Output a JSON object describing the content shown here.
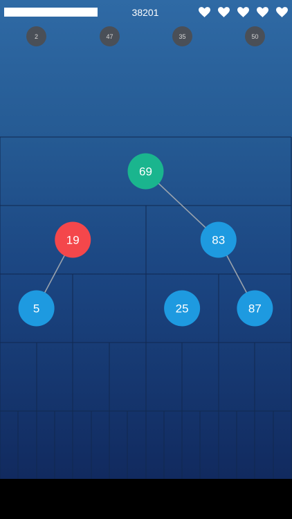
{
  "hud": {
    "progress_fraction": 1.0,
    "score": "38201",
    "lives": 5,
    "heart_icon": "heart-icon"
  },
  "queue": [
    "2",
    "47",
    "35",
    "50"
  ],
  "tree": {
    "depth_levels": 5,
    "nodes": [
      {
        "label": "69",
        "level": 1,
        "index": 0,
        "color": "#1ab58e"
      },
      {
        "label": "19",
        "level": 2,
        "index": 0,
        "color": "#f4474b"
      },
      {
        "label": "83",
        "level": 2,
        "index": 1,
        "color": "#1e9ae0"
      },
      {
        "label": "5",
        "level": 3,
        "index": 0,
        "color": "#1e9ae0"
      },
      {
        "label": "25",
        "level": 3,
        "index": 2,
        "color": "#1e9ae0"
      },
      {
        "label": "87",
        "level": 3,
        "index": 3,
        "color": "#1e9ae0"
      }
    ],
    "edges": [
      [
        "69",
        "83"
      ],
      [
        "19",
        "5"
      ],
      [
        "83",
        "87"
      ]
    ]
  },
  "colors": {
    "grid_line": "#112850",
    "edge_line": "#9aa3ad"
  }
}
